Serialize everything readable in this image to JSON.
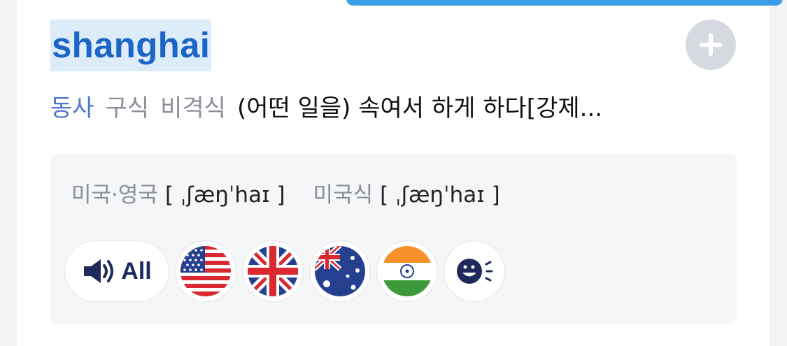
{
  "entry": {
    "word": "shanghai",
    "pos": "동사",
    "tags": [
      "구식",
      "비격식"
    ],
    "meaning": "(어떤 일을) 속여서 하게 하다[강제..."
  },
  "pronunciation": {
    "label_us_uk": "미국·영국",
    "ipa_us_uk": "[ ˌʃæŋˈhaɪ ]",
    "label_us": "미국식",
    "ipa_us": "[ ˌʃæŋˈhaɪ ]"
  },
  "audio_buttons": {
    "all_label": "All",
    "flags": [
      "us-flag-icon",
      "uk-flag-icon",
      "australia-flag-icon",
      "india-flag-icon",
      "ai-voice-icon"
    ]
  },
  "colors": {
    "accent": "#1c64c8",
    "highlight": "#ddecf9",
    "topbar": "#3d9ee8"
  }
}
